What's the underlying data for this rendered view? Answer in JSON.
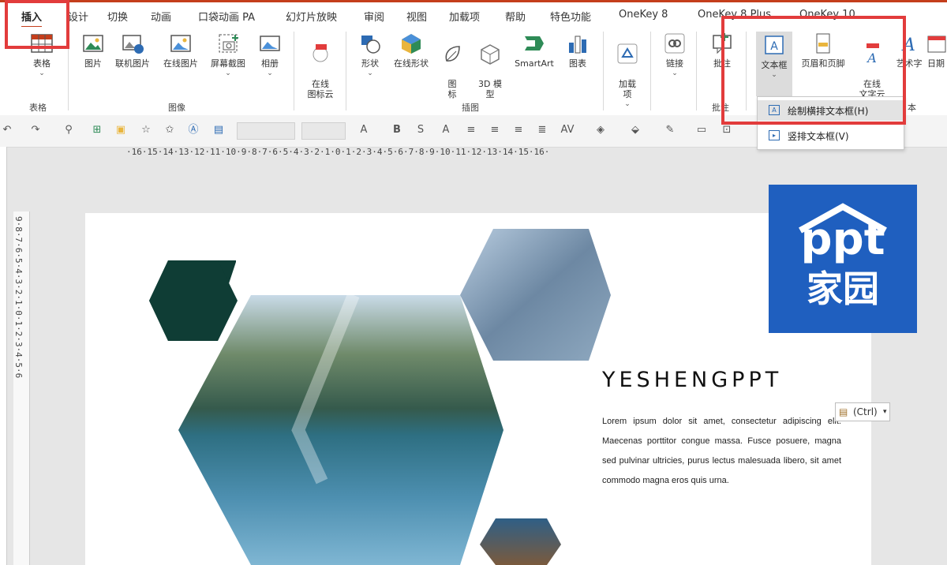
{
  "tabs": [
    "插入",
    "设计",
    "切换",
    "动画",
    "口袋动画 PA",
    "幻灯片放映",
    "审阅",
    "视图",
    "加载项",
    "帮助",
    "特色功能",
    "OneKey 8",
    "OneKey 8 Plus",
    "OneKey 10"
  ],
  "ribbon": {
    "table": "表格",
    "picture": "图片",
    "online_picture": "联机图片",
    "online_image": "在线图片",
    "screenshot": "屏幕截图",
    "album": "相册",
    "icon_cloud": "在线\n图标云",
    "shape": "形状",
    "online_shape": "在线形状",
    "icons": "图\n标",
    "model3d": "3D 模\n型",
    "smartart": "SmartArt",
    "chart": "图表",
    "addin": "加载\n项",
    "link": "链接",
    "comment": "批注",
    "textbox": "文本框",
    "header_footer": "页眉和页脚",
    "word_cloud": "在线\n文字云",
    "wordart": "艺术字",
    "date": "日期",
    "groups": {
      "table": "表格",
      "images": "图像",
      "illustrations": "插图",
      "comment": "批注",
      "text": "本"
    }
  },
  "dropdown": {
    "horizontal": "绘制横排文本框(H)",
    "vertical": "竖排文本框(V)"
  },
  "ruler": "·16·15·14·13·12·11·10·9·8·7·6·5·4·3·2·1·0·1·2·3·4·5·6·7·8·9·10·11·12·13·14·15·16·",
  "vruler": "9·8·7·6·5·4·3·2·1·0·1·2·3·4·5·6",
  "slide": {
    "title": "YESHENGPPT",
    "body": "Lorem ipsum dolor sit amet, consectetur adipiscing elit. Maecenas porttitor congue massa. Fusce posuere, magna sed pulvinar ultricies, purus lectus malesuada libero, sit amet commodo magna eros quis urna.",
    "paste": "(Ctrl)",
    "logo_top": "ppt",
    "logo_bottom": "家园"
  },
  "colors": {
    "accent": "#c43e1c",
    "highlight": "#e23c3c",
    "logo_bg": "#1f5fbf",
    "hex_dark": "#0f3d35"
  }
}
